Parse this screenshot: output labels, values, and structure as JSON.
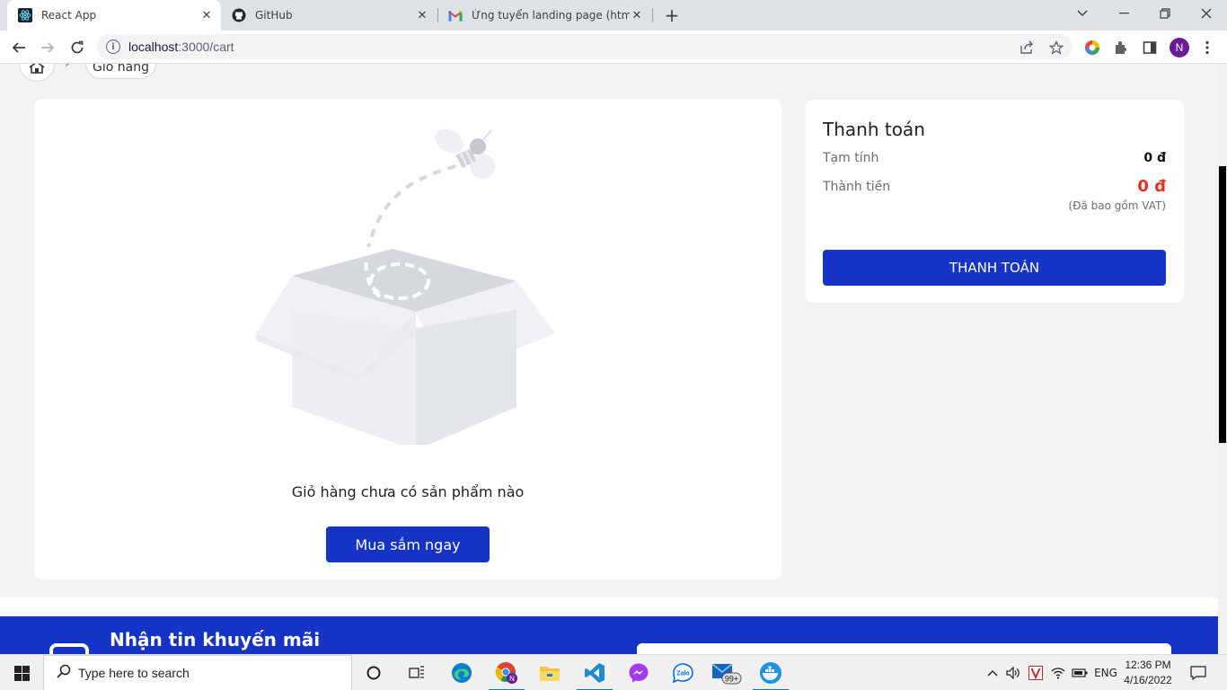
{
  "browser": {
    "tabs": [
      {
        "title": "React App",
        "icon": "react-icon",
        "active": true
      },
      {
        "title": "GitHub",
        "icon": "github-icon",
        "active": false
      },
      {
        "title": "Ứng tuyển landing page (html +",
        "icon": "gmail-icon",
        "active": false
      }
    ],
    "url_host": "localhost",
    "url_path": ":3000/cart",
    "profile_initial": "N"
  },
  "breadcrumb": {
    "home_icon": "home-icon",
    "separator": "›",
    "current": "Giỏ hàng"
  },
  "cart": {
    "empty_message": "Giỏ hàng chưa có sản phẩm nào",
    "shop_button": "Mua sắm ngay"
  },
  "payment": {
    "title": "Thanh toán",
    "subtotal_label": "Tạm tính",
    "subtotal_value": "0 đ",
    "total_label": "Thành tiền",
    "total_value": "0 đ",
    "vat_note": "(Đã bao gồm VAT)",
    "checkout_button": "THANH TOÁN"
  },
  "footer": {
    "promo_title": "Nhận tin khuyến mãi"
  },
  "taskbar": {
    "search_placeholder": "Type here to search",
    "language": "ENG",
    "time": "12:36 PM",
    "date": "4/16/2022",
    "mail_badge": "99+"
  },
  "colors": {
    "primary": "#1533c4",
    "price_red": "#e0321c"
  }
}
